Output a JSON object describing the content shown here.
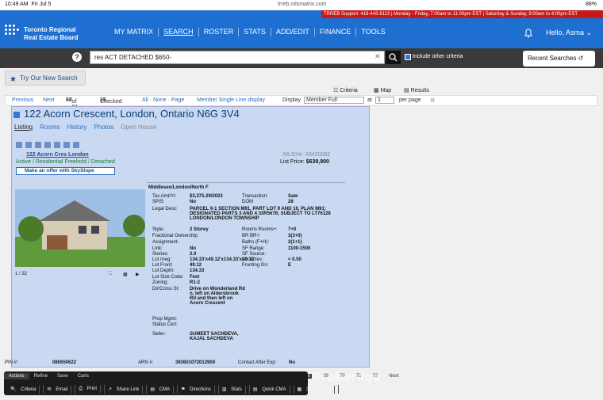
{
  "status": {
    "time": "10:49 AM",
    "day": "Fri Jul 5",
    "url": "trreb.mlsmatrix.com",
    "battery": "88%"
  },
  "support": "TRREB Support: 416-443-8113 | Monday - Friday, 7:00am to 11:00pm EST | Saturday & Sunday, 9:00am to 4:00pm EST",
  "logo": {
    "line1": "Toronto Regional",
    "line2": "Real Estate Board"
  },
  "nav": [
    "MY MATRIX",
    "SEARCH",
    "ROSTER",
    "STATS",
    "ADD/EDIT",
    "FINANCE",
    "TOOLS"
  ],
  "nav_active": 1,
  "user": "Hello, Asma",
  "search": {
    "value": "res ACT DETACHED $650-",
    "include_label": "Include other criteria",
    "recent_label": "Recent Searches"
  },
  "try_label": "Try Our New Search",
  "view_tabs": [
    "Criteria",
    "Map",
    "Results"
  ],
  "pager": {
    "previous": "Previous",
    "next": "Next",
    "count": "68",
    "of": "of 91",
    "checked_label": "Checked",
    "checked": "15",
    "select": "All · None · Page",
    "view": "Member Single Line display",
    "display_label": "Display",
    "display_value": "Member Full",
    "at_label": "at",
    "at_value": "1",
    "per_page": "per page"
  },
  "listing": {
    "address": "122 Acorn Crescent, London, Ontario N6G 3V4",
    "tabs": [
      "Listing",
      "Rooms",
      "History",
      "Photos",
      "Open House"
    ],
    "street": "122 Acorn Cres London",
    "status": "Active / Residential Freehold / Detached",
    "mls": "MLS®#: X8420082",
    "price_label": "List Price:",
    "price": "$639,900",
    "offer": "Make an offer with SkySlope",
    "region": "Middlesex/London/North F",
    "photo_counter": "1 / 32",
    "fields": [
      [
        "Tax Amt/Yr:",
        "$3,375.29/2023"
      ],
      [
        "SPIS:",
        "No"
      ],
      [
        "Legal Desc:",
        "PARCEL 9-1 SECTION M91, PART LOT 9 AND 10, PLAN M91; DESIGNATED PARTS 3 AND 4 33R5678; SUBJECT TO LT76128 LONDON/LONDON TOWNSHIP"
      ],
      [
        "Style:",
        "2 Storey"
      ],
      [
        "Fractional Ownership:",
        ""
      ],
      [
        "Assignment:",
        ""
      ],
      [
        "Link:",
        "No"
      ],
      [
        "Stories:",
        "2.0"
      ],
      [
        "Lot Irreg:",
        "134.33'x49.12'x134.33'x49.12'"
      ],
      [
        "Lot Front:",
        "49.12"
      ],
      [
        "Lot Depth:",
        "134.33"
      ],
      [
        "Lot Size Code:",
        "Feet"
      ],
      [
        "Zoning:",
        "R1-2"
      ],
      [
        "Dir/Cross St:",
        "Drive on Wonderland Rd n, left on Aldersbrook Rd and then left on Acorn Crescent"
      ],
      [
        "Prop Mgmt:",
        ""
      ],
      [
        "Status Cert:",
        ""
      ],
      [
        "Seller:",
        "SUMEET SACHDEVA, KAJAL SACHDEVA"
      ]
    ],
    "fields2": [
      [
        "Transaction:",
        "Sale"
      ],
      [
        "DOM",
        "28"
      ],
      [
        "Rooms Rooms+:",
        "7+0"
      ],
      [
        "BR BR+:",
        "3(3+0)"
      ],
      [
        "Baths (F+H):",
        "2(1+1)"
      ],
      [
        "SF Range:",
        "1100-1500"
      ],
      [
        "SF Source:",
        ""
      ],
      [
        "Lot Acres:",
        "< 0.50"
      ],
      [
        "Fronting On:",
        "E"
      ]
    ],
    "pin_label": "PIN #:",
    "pin": "080650622",
    "arn_label": "ARN #:",
    "arn": "393601072012900",
    "contact_label": "Contact After Exp:",
    "contact": "No"
  },
  "page_numbers": [
    "Previous",
    "61",
    "62",
    "63",
    "64",
    "67",
    "68",
    "69",
    "70",
    "71",
    "72",
    "Next"
  ],
  "watermark": "PRESENT REALTY Brokerage",
  "actions": {
    "tabs": [
      "Actions",
      "Refine",
      "Save",
      "Carts"
    ],
    "buttons": [
      "Criteria",
      "Email",
      "Print",
      "Share Link",
      "CMA",
      "Directions",
      "Stats",
      "Quick CMA",
      "3-Up Comp"
    ]
  }
}
